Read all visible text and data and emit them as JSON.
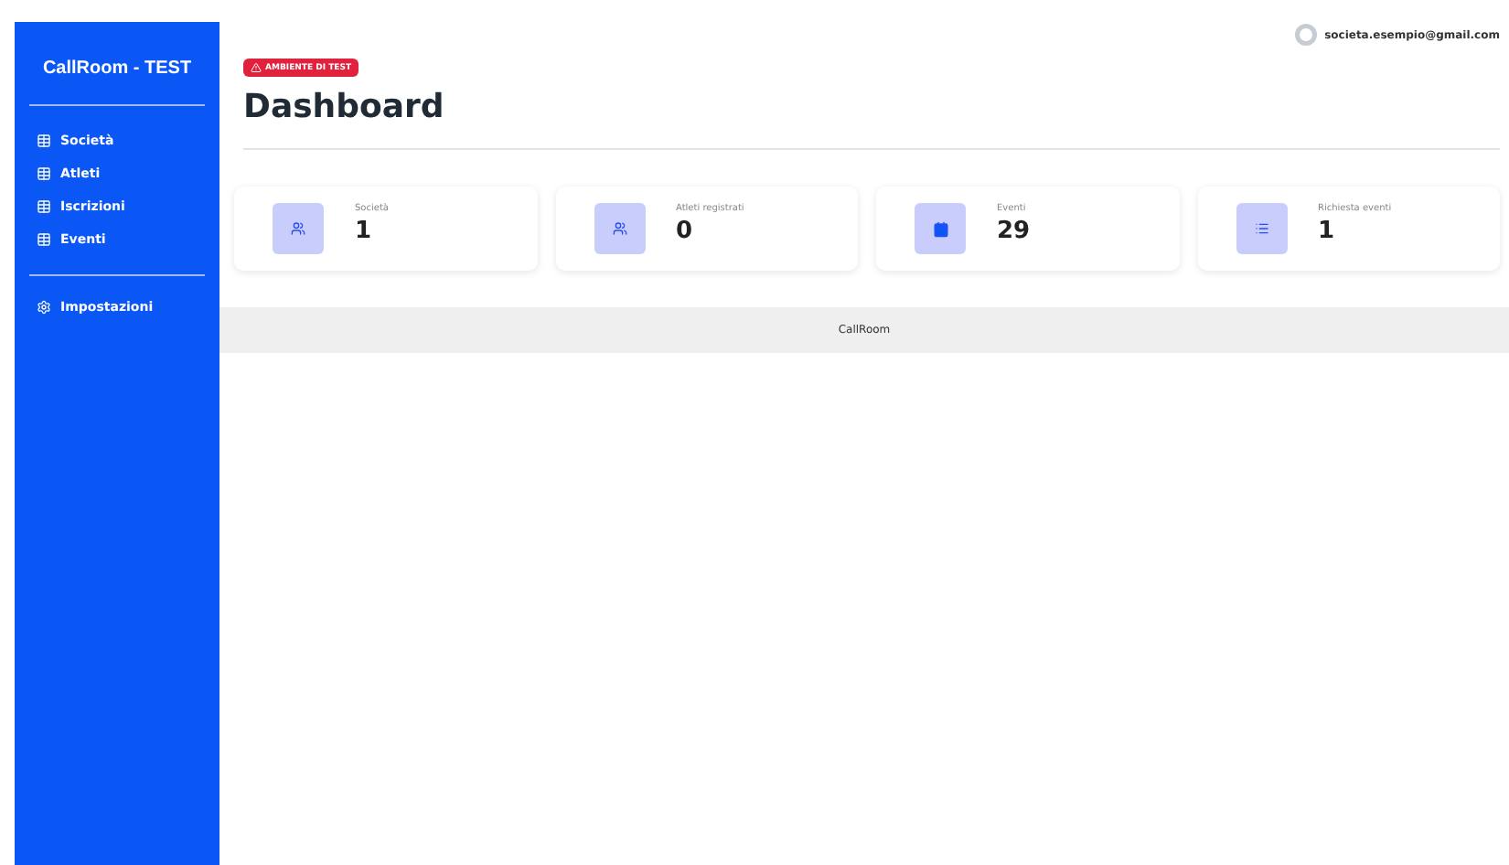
{
  "sidebar": {
    "title": "CallRoom - TEST",
    "items": [
      {
        "label": "Società",
        "kind": "table"
      },
      {
        "label": "Atleti",
        "kind": "table"
      },
      {
        "label": "Iscrizioni",
        "kind": "table"
      },
      {
        "label": "Eventi",
        "kind": "table"
      }
    ],
    "settings": {
      "label": "Impostazioni"
    }
  },
  "user": {
    "email": "societa.esempio@gmail.com"
  },
  "badge": "AMBIENTE DI TEST",
  "title": "Dashboard",
  "stats": [
    {
      "label": "Società",
      "value": "1",
      "kind": "users"
    },
    {
      "label": "Atleti registrati",
      "value": "0",
      "kind": "users"
    },
    {
      "label": "Eventi",
      "value": "29",
      "kind": "calendar"
    },
    {
      "label": "Richiesta eventi",
      "value": "1",
      "kind": "list"
    }
  ],
  "footer": "CallRoom"
}
